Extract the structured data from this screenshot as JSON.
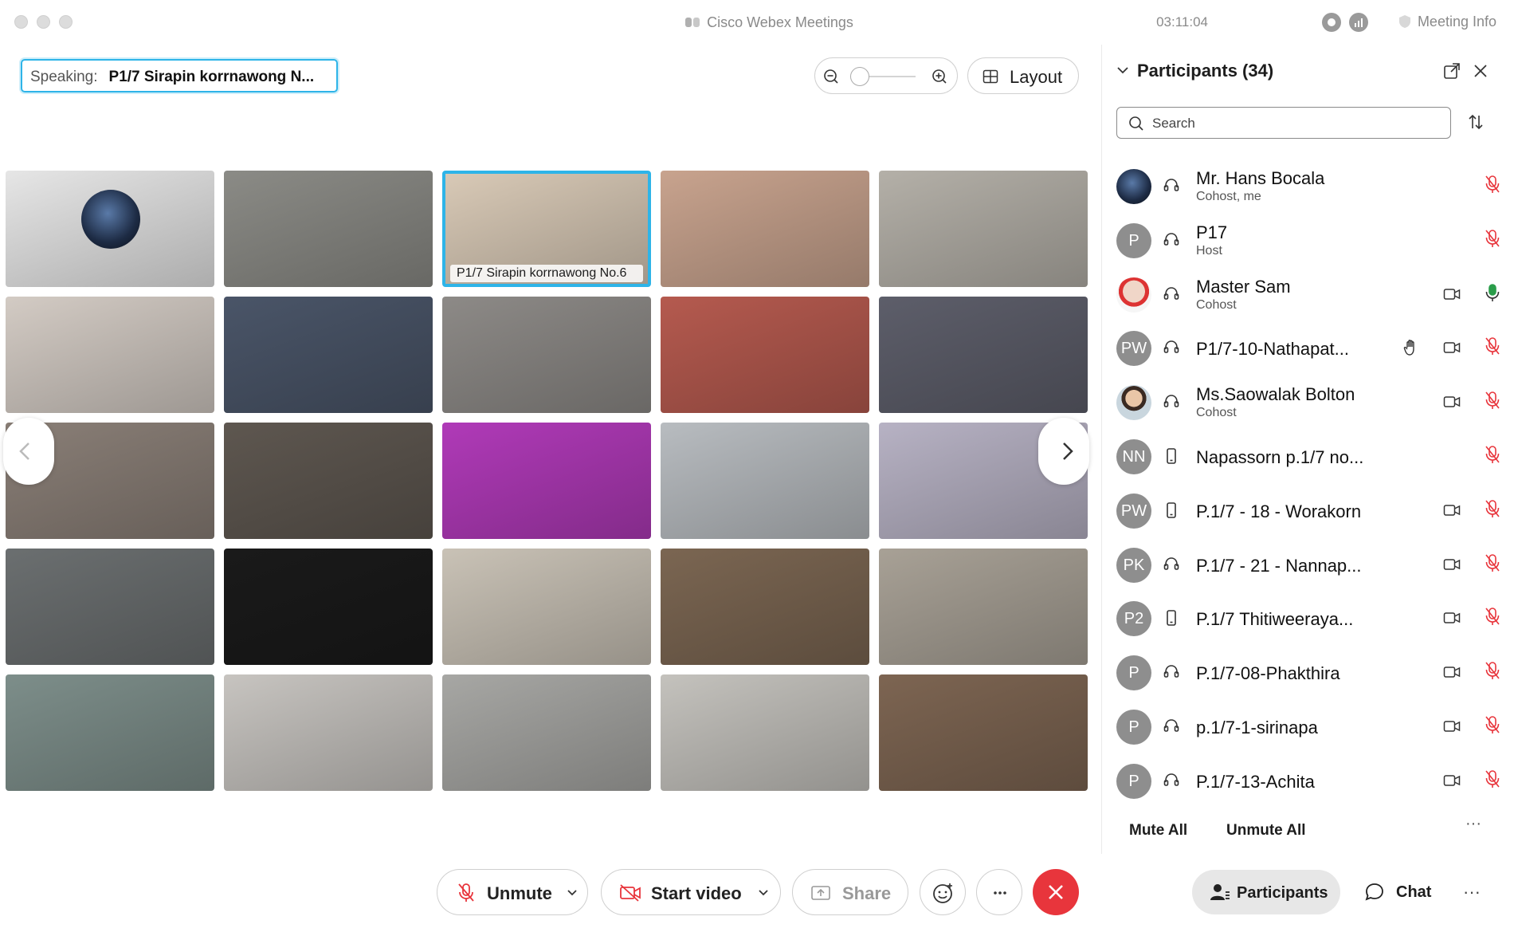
{
  "window": {
    "title": "Cisco Webex Meetings",
    "timer": "03:11:04",
    "meeting_info": "Meeting Info"
  },
  "speaking": {
    "label": "Speaking:",
    "name": "P1/7 Sirapin korrnawong N..."
  },
  "toolbar_top": {
    "layout_label": "Layout"
  },
  "grid": {
    "active_tile_name": "P1/7 Sirapin korrnawong No.6",
    "tile_colors": [
      "#e6e6e6",
      "#8b8b86",
      "#d8c9b6",
      "#c8a38e",
      "#b4b0a8",
      "#d3cbc4",
      "#4a5568",
      "#8d8a87",
      "#b55a4f",
      "#5d5e6a",
      "#8a7f77",
      "#5e5750",
      "#b03ab8",
      "#b8bcc0",
      "#b7b2c4",
      "#6b6f70",
      "#1a1a1a",
      "#c9c2b6",
      "#7b6652",
      "#a8a196",
      "#7d8e8a",
      "#c7c4c0",
      "#a7a7a4",
      "#c4c2bd",
      "#7d6552"
    ]
  },
  "participants": {
    "title": "Participants (34)",
    "search_placeholder": "Search",
    "rows": [
      {
        "initials": "",
        "name": "Mr. Hans Bocala",
        "sub": "Cohost, me",
        "device": "headset",
        "video": false,
        "mic": "muted"
      },
      {
        "initials": "P",
        "name": "P17",
        "sub": "Host",
        "device": "headset",
        "video": false,
        "mic": "muted"
      },
      {
        "initials": "",
        "name": "Master Sam",
        "sub": "Cohost",
        "device": "headset",
        "video": true,
        "mic": "active"
      },
      {
        "initials": "PW",
        "name": "P1/7-10-Nathapat...",
        "sub": "",
        "device": "headset",
        "video": true,
        "mic": "muted",
        "hand": true
      },
      {
        "initials": "",
        "name": "Ms.Saowalak Bolton",
        "sub": "Cohost",
        "device": "headset",
        "video": true,
        "mic": "muted"
      },
      {
        "initials": "NN",
        "name": "Napassorn p.1/7 no...",
        "sub": "",
        "device": "phone",
        "video": false,
        "mic": "muted"
      },
      {
        "initials": "PW",
        "name": "P.1/7 - 18 - Worakorn",
        "sub": "",
        "device": "phone",
        "video": true,
        "mic": "muted"
      },
      {
        "initials": "PK",
        "name": "P.1/7 - 21 - Nannap...",
        "sub": "",
        "device": "headset",
        "video": true,
        "mic": "muted"
      },
      {
        "initials": "P2",
        "name": "P.1/7 Thitiweeraya...",
        "sub": "",
        "device": "phone",
        "video": true,
        "mic": "muted"
      },
      {
        "initials": "P",
        "name": "P.1/7-08-Phakthira",
        "sub": "",
        "device": "headset",
        "video": true,
        "mic": "muted"
      },
      {
        "initials": "P",
        "name": "p.1/7-1-sirinapa",
        "sub": "",
        "device": "headset",
        "video": true,
        "mic": "muted"
      },
      {
        "initials": "P",
        "name": "P.1/7-13-Achita",
        "sub": "",
        "device": "headset",
        "video": true,
        "mic": "muted"
      }
    ],
    "mute_all": "Mute All",
    "unmute_all": "Unmute All"
  },
  "toolbar_bottom": {
    "unmute": "Unmute",
    "start_video": "Start video",
    "share": "Share",
    "participants": "Participants",
    "chat": "Chat"
  },
  "colors": {
    "accent": "#2eb4e8",
    "mute_red": "#e8353c",
    "mic_green": "#2a9d4a"
  }
}
